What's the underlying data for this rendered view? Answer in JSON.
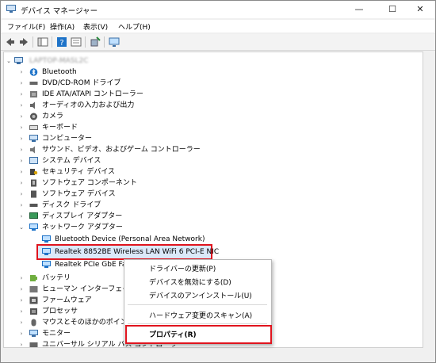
{
  "window": {
    "title": "デバイス マネージャー",
    "minimize": "—",
    "maximize": "☐",
    "close": "✕"
  },
  "menu": [
    "ファイル(F)",
    "操作(A)",
    "表示(V)",
    "ヘルプ(H)"
  ],
  "toolbar": {
    "icons": [
      "back-icon",
      "forward-icon",
      "show-hide-tree-icon",
      "help-icon",
      "properties-icon",
      "scan-hardware-icon",
      "monitor-icon"
    ]
  },
  "tree": {
    "root": "LAPTOP-MASL2C",
    "categories": [
      {
        "label": "Bluetooth",
        "icon": "bluetooth-icon"
      },
      {
        "label": "DVD/CD-ROM ドライブ",
        "icon": "dvd-drive-icon"
      },
      {
        "label": "IDE ATA/ATAPI コントローラー",
        "icon": "ide-controller-icon"
      },
      {
        "label": "オーディオの入力および出力",
        "icon": "speaker-icon"
      },
      {
        "label": "カメラ",
        "icon": "camera-icon"
      },
      {
        "label": "キーボード",
        "icon": "keyboard-icon"
      },
      {
        "label": "コンピューター",
        "icon": "computer-icon"
      },
      {
        "label": "サウンド、ビデオ、およびゲーム コントローラー",
        "icon": "sound-icon"
      },
      {
        "label": "システム デバイス",
        "icon": "system-device-icon"
      },
      {
        "label": "セキュリティ デバイス",
        "icon": "security-device-icon"
      },
      {
        "label": "ソフトウェア コンポーネント",
        "icon": "software-component-icon"
      },
      {
        "label": "ソフトウェア デバイス",
        "icon": "software-device-icon"
      },
      {
        "label": "ディスク ドライブ",
        "icon": "disk-drive-icon"
      },
      {
        "label": "ディスプレイ アダプター",
        "icon": "display-adapter-icon"
      },
      {
        "label": "ネットワーク アダプター",
        "icon": "network-adapter-icon",
        "expanded": true
      }
    ],
    "network_children": [
      "Bluetooth Device (Personal Area Network)",
      "Realtek 8852BE Wireless LAN WiFi 6 PCI-E NIC",
      "Realtek PCIe GbE Fam"
    ],
    "after": [
      {
        "label": "バッテリ",
        "icon": "battery-icon"
      },
      {
        "label": "ヒューマン インターフェイス デ",
        "icon": "hid-icon"
      },
      {
        "label": "ファームウェア",
        "icon": "firmware-icon"
      },
      {
        "label": "プロセッサ",
        "icon": "processor-icon"
      },
      {
        "label": "マウスとそのほかのポインティ",
        "icon": "mouse-icon"
      },
      {
        "label": "モニター",
        "icon": "monitor-icon"
      },
      {
        "label": "ユニバーサル シリアル バス コントローラー",
        "icon": "usb-icon"
      }
    ]
  },
  "context_menu": {
    "update_driver": "ドライバーの更新(P)",
    "disable_device": "デバイスを無効にする(D)",
    "uninstall_device": "デバイスのアンインストール(U)",
    "scan_hardware": "ハードウェア変更のスキャン(A)",
    "properties": "プロパティ(R)"
  },
  "colors": {
    "highlight": "#e0141e",
    "selection": "#dbe9f9",
    "icon_blue": "#1e73c8"
  }
}
